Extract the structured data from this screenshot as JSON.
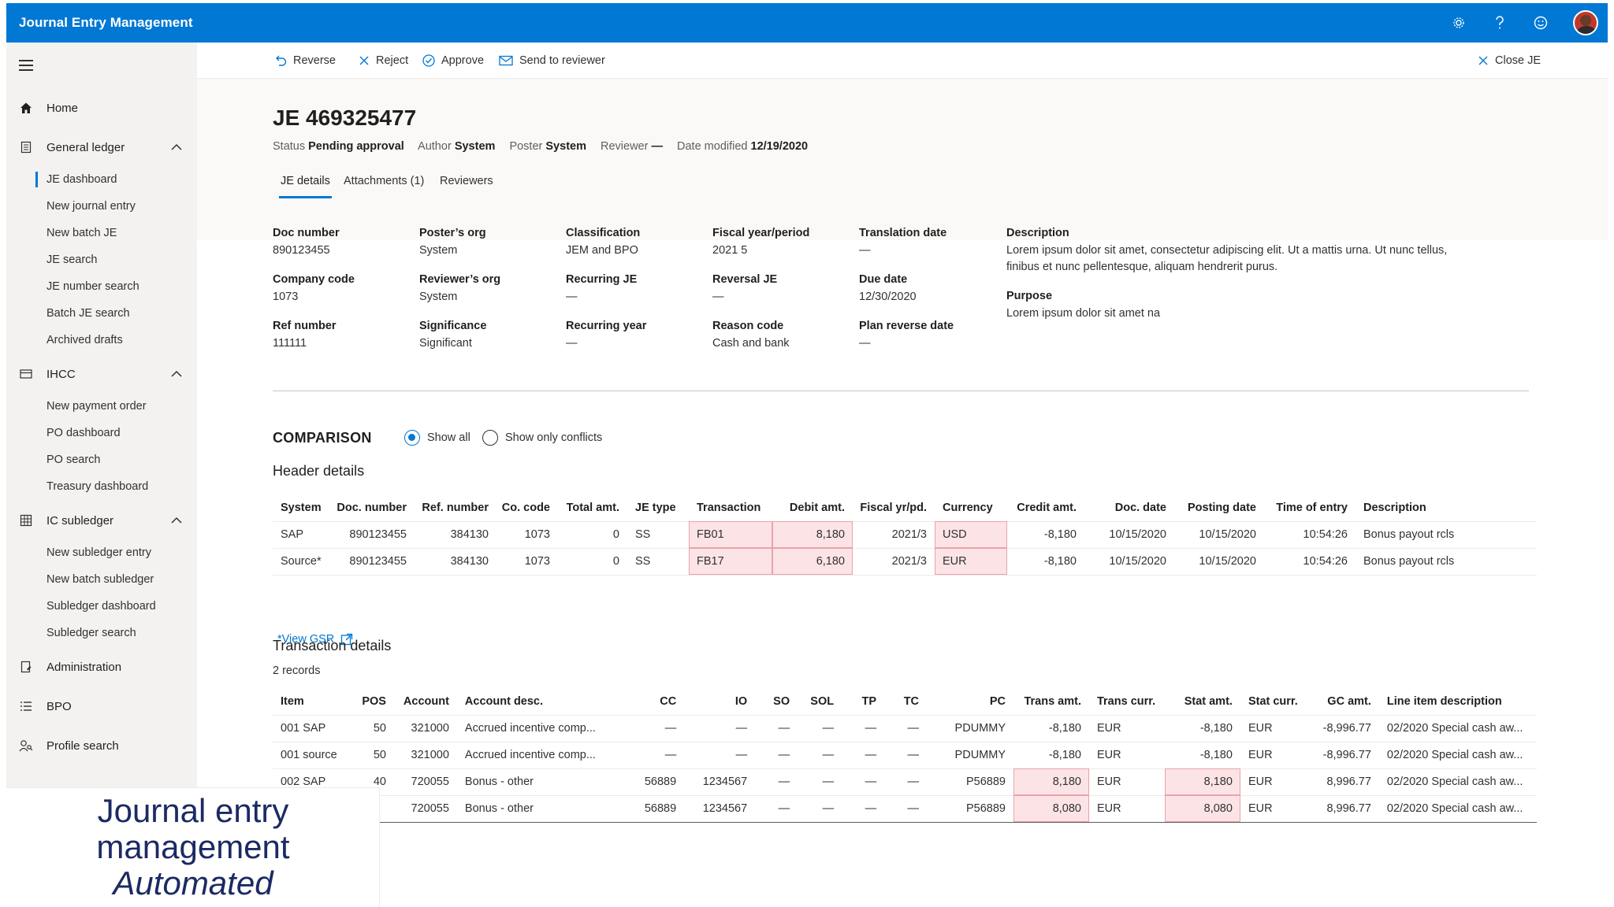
{
  "app": {
    "title": "Journal Entry Management"
  },
  "header_icons": [
    "gear-icon",
    "help-icon",
    "feedback-smile-icon",
    "avatar"
  ],
  "sidebar": {
    "home": "Home",
    "general_ledger": {
      "label": "General ledger",
      "items": [
        "JE dashboard",
        "New journal entry",
        "New batch JE",
        "JE search",
        "JE number search",
        "Batch JE search",
        "Archived drafts"
      ]
    },
    "ihcc": {
      "label": "IHCC",
      "items": [
        "New payment order",
        "PO dashboard",
        "PO search",
        "Treasury dashboard"
      ]
    },
    "ic_subledger": {
      "label": "IC subledger",
      "items": [
        "New subledger entry",
        "New batch subledger",
        "Subledger dashboard",
        "Subledger search"
      ]
    },
    "administration": "Administration",
    "bpo": "BPO",
    "profile_search": "Profile search"
  },
  "promo": {
    "line1": "Journal entry",
    "line2": "management",
    "line3": "Automated"
  },
  "toolbar": {
    "reverse": "Reverse",
    "reject": "Reject",
    "approve": "Approve",
    "send": "Send to reviewer",
    "close": "Close JE"
  },
  "je": {
    "title": "JE 469325477",
    "meta": {
      "status_k": "Status",
      "status_v": "Pending approval",
      "author_k": "Author",
      "author_v": "System",
      "poster_k": "Poster",
      "poster_v": "System",
      "reviewer_k": "Reviewer",
      "reviewer_v": "—",
      "date_k": "Date modified",
      "date_v": "12/19/2020"
    }
  },
  "tabs": [
    "JE details",
    "Attachments (1)",
    "Reviewers"
  ],
  "details": {
    "doc_number": {
      "label": "Doc number",
      "value": "890123455"
    },
    "company_code": {
      "label": "Company code",
      "value": "1073"
    },
    "ref_number": {
      "label": "Ref number",
      "value": "111111"
    },
    "posters_org": {
      "label": "Poster’s org",
      "value": "System"
    },
    "reviewers_org": {
      "label": "Reviewer’s org",
      "value": "System"
    },
    "significance": {
      "label": "Significance",
      "value": "Significant"
    },
    "classification": {
      "label": "Classification",
      "value": "JEM and BPO"
    },
    "recurring_je": {
      "label": "Recurring JE",
      "value": "—"
    },
    "recurring_year": {
      "label": "Recurring year",
      "value": "—"
    },
    "fiscal": {
      "label": "Fiscal year/period",
      "value": "2021 5"
    },
    "reversal_je": {
      "label": "Reversal JE",
      "value": "—"
    },
    "reason_code": {
      "label": "Reason code",
      "value": "Cash and bank"
    },
    "translation_date": {
      "label": "Translation date",
      "value": "—"
    },
    "due_date": {
      "label": "Due date",
      "value": "12/30/2020"
    },
    "plan_reverse_date": {
      "label": "Plan reverse date",
      "value": "—"
    },
    "description": {
      "label": "Description",
      "value": "Lorem ipsum dolor sit amet, consectetur adipiscing elit. Ut a mattis urna. Ut nunc tellus, finibus et nunc pellentesque, aliquam hendrerit purus."
    },
    "purpose": {
      "label": "Purpose",
      "value": "Lorem ipsum dolor sit amet na"
    }
  },
  "comparison": {
    "title": "COMPARISON",
    "show_all": "Show all",
    "show_conflicts": "Show only conflicts",
    "selected": "Show all"
  },
  "header_details": {
    "title": "Header details",
    "columns": [
      "System",
      "Doc. number",
      "Ref. number",
      "Co. code",
      "Total amt.",
      "JE type",
      "Transaction",
      "Debit amt.",
      "Fiscal yr/pd.",
      "Currency",
      "Credit amt.",
      "Doc. date",
      "Posting date",
      "Time of entry",
      "Description"
    ],
    "rows": [
      [
        "SAP",
        "890123455",
        "384130",
        "1073",
        "0",
        "SS",
        "FB01",
        "8,180",
        "2021/3",
        "USD",
        "-8,180",
        "10/15/2020",
        "10/15/2020",
        "10:54:26",
        "Bonus payout rcls"
      ],
      [
        "Source*",
        "890123455",
        "384130",
        "1073",
        "0",
        "SS",
        "FB17",
        "6,180",
        "2021/3",
        "EUR",
        "-8,180",
        "10/15/2020",
        "10/15/2020",
        "10:54:26",
        "Bonus payout rcls"
      ]
    ],
    "view_gsr": "*View GSR"
  },
  "transaction_details": {
    "title": "Transaction details",
    "records": "2 records",
    "columns": [
      "Item",
      "POS",
      "Account",
      "Account desc.",
      "CC",
      "IO",
      "SO",
      "SOL",
      "TP",
      "TC",
      "PC",
      "Trans amt.",
      "Trans curr.",
      "Stat amt.",
      "Stat curr.",
      "GC amt.",
      "Line item description"
    ],
    "rows": [
      [
        "001 SAP",
        "50",
        "321000",
        "Accrued incentive comp...",
        "—",
        "—",
        "—",
        "—",
        "—",
        "—",
        "PDUMMY",
        "-8,180",
        "EUR",
        "-8,180",
        "EUR",
        "-8,996.77",
        "02/2020 Special cash aw..."
      ],
      [
        "001 source",
        "50",
        "321000",
        "Accrued incentive comp...",
        "—",
        "—",
        "—",
        "—",
        "—",
        "—",
        "PDUMMY",
        "-8,180",
        "EUR",
        "-8,180",
        "EUR",
        "-8,996.77",
        "02/2020 Special cash aw..."
      ],
      [
        "002 SAP",
        "40",
        "720055",
        "Bonus - other",
        "56889",
        "1234567",
        "—",
        "—",
        "—",
        "—",
        "P56889",
        "8,180",
        "EUR",
        "8,180",
        "EUR",
        "8,996.77",
        "02/2020 Special cash aw..."
      ],
      [
        "",
        "",
        "720055",
        "Bonus - other",
        "56889",
        "1234567",
        "—",
        "—",
        "—",
        "—",
        "P56889",
        "8,080",
        "EUR",
        "8,080",
        "EUR",
        "8,996.77",
        "02/2020 Special cash aw..."
      ]
    ]
  },
  "colors": {
    "accent": "#0078d4",
    "conflict_fill": "#fce4e6",
    "conflict_border": "#e8a3a9",
    "promo_text": "#1b2a63"
  }
}
